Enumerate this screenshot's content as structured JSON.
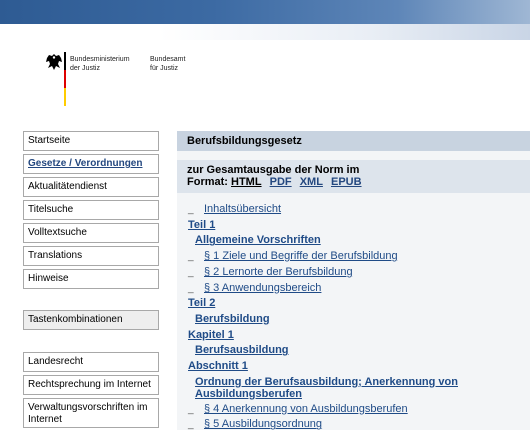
{
  "header": {
    "ministry_label": "Bundesministerium\nder Justiz",
    "office_label": "Bundesamt\nfür Justiz",
    "eagle_icon": "federal-eagle-icon",
    "flag_colors": [
      "#000000",
      "#dd0000",
      "#ffcc00"
    ]
  },
  "sidebar": {
    "items": [
      {
        "label": "Startseite"
      },
      {
        "label": "Gesetze / Verordnungen"
      },
      {
        "label": "Aktualitätendienst"
      },
      {
        "label": "Titelsuche"
      },
      {
        "label": "Volltextsuche"
      },
      {
        "label": "Translations"
      },
      {
        "label": "Hinweise"
      },
      {
        "label": "Tastenkombinationen"
      },
      {
        "label": "Landesrecht"
      },
      {
        "label": "Rechtsprechung im Internet"
      },
      {
        "label": "Verwaltungsvorschriften im Internet"
      }
    ]
  },
  "main": {
    "title": "Berufsbildungsgesetz",
    "format_intro": "zur Gesamtausgabe der Norm im",
    "format_label": "Format:",
    "formats": [
      "HTML",
      "PDF",
      "XML",
      "EPUB"
    ],
    "toc": [
      {
        "text": "Inhaltsübersicht"
      },
      {
        "text": "Teil 1"
      },
      {
        "text": "Allgemeine Vorschriften"
      },
      {
        "text": "§ 1 Ziele und Begriffe der Berufsbildung"
      },
      {
        "text": "§ 2 Lernorte der Berufsbildung"
      },
      {
        "text": "§ 3 Anwendungsbereich"
      },
      {
        "text": "Teil 2"
      },
      {
        "text": "Berufsbildung"
      },
      {
        "text": "Kapitel 1"
      },
      {
        "text": "Berufsausbildung"
      },
      {
        "text": "Abschnitt 1"
      },
      {
        "text": "Ordnung der Berufsausbildung; Anerkennung von Ausbildungsberufen"
      },
      {
        "text": "§ 4 Anerkennung von Ausbildungsberufen"
      },
      {
        "text": "§ 5 Ausbildungsordnung"
      }
    ],
    "bullet": "_"
  },
  "colors": {
    "banner": "#2e5b93",
    "link": "#1f4b87",
    "header_bar": "#c8d3e0",
    "format_box": "#dde4ec"
  }
}
